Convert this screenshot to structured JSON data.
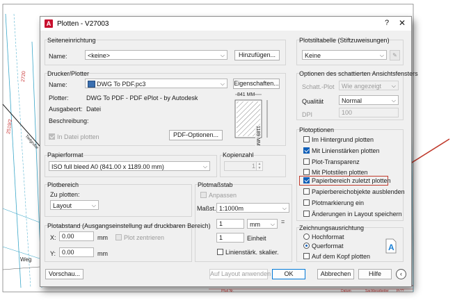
{
  "background": {
    "labels": [
      "2720",
      "2519/2",
      "Tiefgrube",
      "Weg",
      "Pfud Nr.",
      "Datum",
      "Sachbearbeiter",
      "Pr??"
    ]
  },
  "dialog": {
    "title": "Plotten - V27003",
    "page_setup": {
      "group": "Seiteneinrichtung",
      "name_label": "Name:",
      "name_value": "<keine>",
      "add_button": "Hinzufügen..."
    },
    "printer": {
      "group": "Drucker/Plotter",
      "name_label": "Name:",
      "name_value": "DWG To PDF.pc3",
      "properties_button": "Eigenschaften...",
      "plotter_label": "Plotter:",
      "plotter_value": "DWG To PDF - PDF ePlot - by Autodesk",
      "location_label": "Ausgabeort:",
      "location_value": "Datei",
      "description_label": "Beschreibung:",
      "plot_to_file": "In Datei plotten",
      "pdf_options_button": "PDF-Optionen...",
      "preview_width": "841 MM",
      "preview_height": "1189 MM"
    },
    "paper_size": {
      "group": "Papierformat",
      "value": "ISO full bleed A0 (841.00 x 1189.00 mm)"
    },
    "copies": {
      "group": "Kopienzahl",
      "value": "1"
    },
    "plot_area": {
      "group": "Plotbereich",
      "what_label": "Zu plotten:",
      "what_value": "Layout"
    },
    "plot_scale": {
      "group": "Plotmaßstab",
      "fit_paper": "Anpassen",
      "scale_label": "Maßst.:",
      "scale_value": "1:1000m",
      "value1": "1",
      "unit_value": "mm",
      "value2": "1",
      "unit_label": "Einheit",
      "lineweights": "Linienstärk. skalier.",
      "equals": "="
    },
    "plot_offset": {
      "group": "Plotabstand (Ausgangseinstellung auf druckbaren Bereich)",
      "x_label": "X:",
      "x_value": "0.00",
      "x_unit": "mm",
      "center": "Plot zentrieren",
      "y_label": "Y:",
      "y_value": "0.00",
      "y_unit": "mm"
    },
    "plot_style_table": {
      "group": "Plotstiltabelle (Stiftzuweisungen)",
      "value": "Keine"
    },
    "shaded_viewport": {
      "group": "Optionen des schattierten Ansichtsfensters",
      "shade_label": "Schatt.-Plot",
      "shade_value": "Wie angezeigt",
      "quality_label": "Qualität",
      "quality_value": "Normal",
      "dpi_label": "DPI",
      "dpi_value": "100"
    },
    "plot_options": {
      "group": "Plotoptionen",
      "items": [
        {
          "label": "Im Hintergrund plotten",
          "checked": false
        },
        {
          "label": "Mit Linienstärken plotten",
          "checked": true
        },
        {
          "label": "Plot-Transparenz",
          "checked": false
        },
        {
          "label": "Mit Plotstilen plotten",
          "checked": false
        },
        {
          "label": "Papierbereich zuletzt plotten",
          "checked": true
        },
        {
          "label": "Papierbereichobjekte ausblenden",
          "checked": false
        },
        {
          "label": "Plotmarkierung ein",
          "checked": false
        },
        {
          "label": "Änderungen in Layout speichern",
          "checked": false
        }
      ]
    },
    "orientation": {
      "group": "Zeichnungsausrichtung",
      "portrait": "Hochformat",
      "landscape": "Querformat",
      "selected": "Querformat",
      "upside_down": "Auf dem Kopf plotten"
    },
    "footer": {
      "preview": "Vorschau...",
      "apply_layout": "Auf Layout anwenden",
      "ok": "OK",
      "cancel": "Abbrechen",
      "help": "Hilfe"
    },
    "colors": {
      "accent": "#0f5fb8",
      "highlight": "#c0392b",
      "cad_line": "#3aa7c9"
    }
  }
}
